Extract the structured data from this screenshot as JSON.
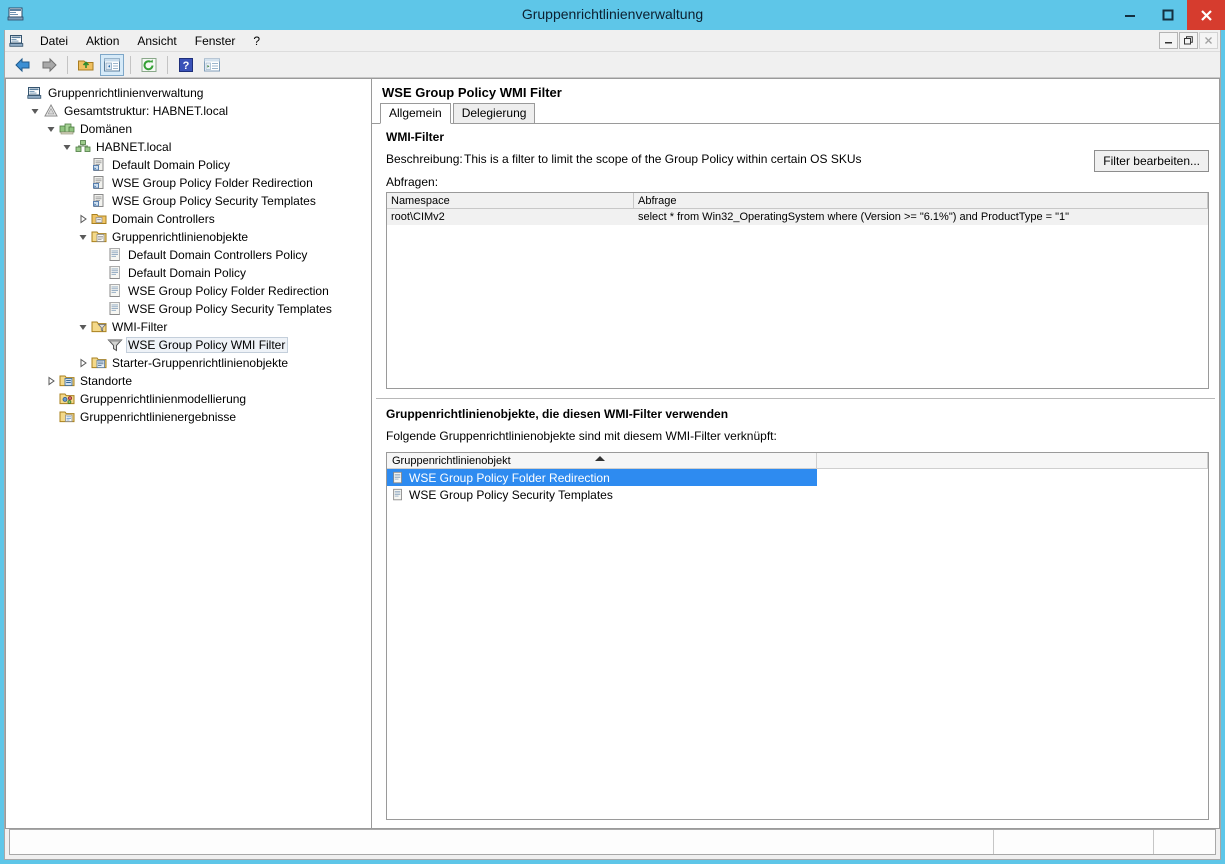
{
  "window": {
    "title": "Gruppenrichtlinienverwaltung",
    "icon": "mmc-console-icon",
    "minimize_label": "–",
    "maximize_label": "□",
    "close_label": "✕"
  },
  "mdi_buttons": {
    "minimize": "–",
    "restore": "❐",
    "close": "✕"
  },
  "menu": {
    "items": [
      {
        "label": "Datei",
        "name": "menu-datei"
      },
      {
        "label": "Aktion",
        "name": "menu-aktion"
      },
      {
        "label": "Ansicht",
        "name": "menu-ansicht"
      },
      {
        "label": "Fenster",
        "name": "menu-fenster"
      },
      {
        "label": "?",
        "name": "menu-help"
      }
    ]
  },
  "toolbar": {
    "buttons": [
      {
        "name": "back-button",
        "icon": "arrow-left-icon"
      },
      {
        "name": "forward-button",
        "icon": "arrow-right-icon"
      },
      {
        "name": "up-one-level-button",
        "icon": "folder-up-icon"
      },
      {
        "name": "show-hide-tree-button",
        "icon": "console-tree-icon"
      },
      {
        "name": "refresh-button",
        "icon": "refresh-icon"
      },
      {
        "name": "help-button",
        "icon": "question-mark-icon"
      },
      {
        "name": "show-action-pane-button",
        "icon": "action-pane-icon"
      }
    ]
  },
  "tree": {
    "nodes": [
      {
        "label": "Gruppenrichtlinienverwaltung",
        "indent": 0,
        "expander": "none",
        "icon": "mmc-console-icon",
        "selected": false
      },
      {
        "label": "Gesamtstruktur: HABNET.local",
        "indent": 1,
        "expander": "expanded",
        "icon": "forest-icon",
        "selected": false
      },
      {
        "label": "Domänen",
        "indent": 2,
        "expander": "expanded",
        "icon": "domains-icon",
        "selected": false
      },
      {
        "label": "HABNET.local",
        "indent": 3,
        "expander": "expanded",
        "icon": "domain-icon",
        "selected": false
      },
      {
        "label": "Default Domain Policy",
        "indent": 4,
        "expander": "none",
        "icon": "gpo-link-icon",
        "selected": false
      },
      {
        "label": "WSE Group Policy Folder Redirection",
        "indent": 4,
        "expander": "none",
        "icon": "gpo-link-icon",
        "selected": false
      },
      {
        "label": "WSE Group Policy Security Templates",
        "indent": 4,
        "expander": "none",
        "icon": "gpo-link-icon",
        "selected": false
      },
      {
        "label": "Domain Controllers",
        "indent": 4,
        "expander": "collapsed",
        "icon": "ou-icon",
        "selected": false
      },
      {
        "label": "Gruppenrichtlinienobjekte",
        "indent": 4,
        "expander": "expanded",
        "icon": "gpo-folder-icon",
        "selected": false
      },
      {
        "label": "Default Domain Controllers Policy",
        "indent": 5,
        "expander": "none",
        "icon": "gpo-icon",
        "selected": false
      },
      {
        "label": "Default Domain Policy",
        "indent": 5,
        "expander": "none",
        "icon": "gpo-icon",
        "selected": false
      },
      {
        "label": "WSE Group Policy Folder Redirection",
        "indent": 5,
        "expander": "none",
        "icon": "gpo-icon",
        "selected": false
      },
      {
        "label": "WSE Group Policy Security Templates",
        "indent": 5,
        "expander": "none",
        "icon": "gpo-icon",
        "selected": false
      },
      {
        "label": "WMI-Filter",
        "indent": 4,
        "expander": "expanded",
        "icon": "wmi-folder-icon",
        "selected": false
      },
      {
        "label": "WSE Group Policy WMI Filter",
        "indent": 5,
        "expander": "none",
        "icon": "wmi-filter-icon",
        "selected": true
      },
      {
        "label": "Starter-Gruppenrichtlinienobjekte",
        "indent": 4,
        "expander": "collapsed",
        "icon": "starter-gpo-icon",
        "selected": false
      },
      {
        "label": "Standorte",
        "indent": 2,
        "expander": "collapsed",
        "icon": "sites-icon",
        "selected": false
      },
      {
        "label": "Gruppenrichtlinienmodellierung",
        "indent": 2,
        "expander": "none",
        "icon": "gp-modeling-icon",
        "selected": false
      },
      {
        "label": "Gruppenrichtlinienergebnisse",
        "indent": 2,
        "expander": "none",
        "icon": "gp-results-icon",
        "selected": false
      }
    ]
  },
  "details": {
    "title": "WSE Group Policy WMI Filter",
    "tabs": [
      {
        "label": "Allgemein",
        "name": "tab-allgemein",
        "active": true
      },
      {
        "label": "Delegierung",
        "name": "tab-delegierung",
        "active": false
      }
    ],
    "general": {
      "heading": "WMI-Filter",
      "description_label": "Beschreibung:",
      "description_value": "This is a filter to limit the scope of the Group Policy within certain OS SKUs",
      "queries_label": "Abfragen:",
      "edit_filter_button": "Filter bearbeiten...",
      "query_grid": {
        "columns": [
          "Namespace",
          "Abfrage"
        ],
        "rows": [
          {
            "namespace": "root\\CIMv2",
            "query": "select * from Win32_OperatingSystem where (Version >= \"6.1%\") and ProductType = \"1\""
          }
        ]
      }
    },
    "linked_gpos": {
      "heading": "Gruppenrichtlinienobjekte, die diesen WMI-Filter verwenden",
      "subtitle": "Folgende Gruppenrichtlinienobjekte sind mit diesem WMI-Filter verknüpft:",
      "columns": [
        "Gruppenrichtlinienobjekt",
        ""
      ],
      "sort": "ascending",
      "rows": [
        {
          "label": "WSE Group Policy Folder Redirection",
          "selected": true
        },
        {
          "label": "WSE Group Policy Security Templates",
          "selected": false
        }
      ]
    }
  },
  "status_bar": {
    "text": ""
  },
  "colors": {
    "titlebar": "#5ec6e8",
    "close_button": "#d63c2e",
    "selection_blue": "#2e8bf0",
    "tree_selection": "#eef2f7",
    "pane_background": "#ffffff",
    "chrome": "#f0f0f0"
  }
}
